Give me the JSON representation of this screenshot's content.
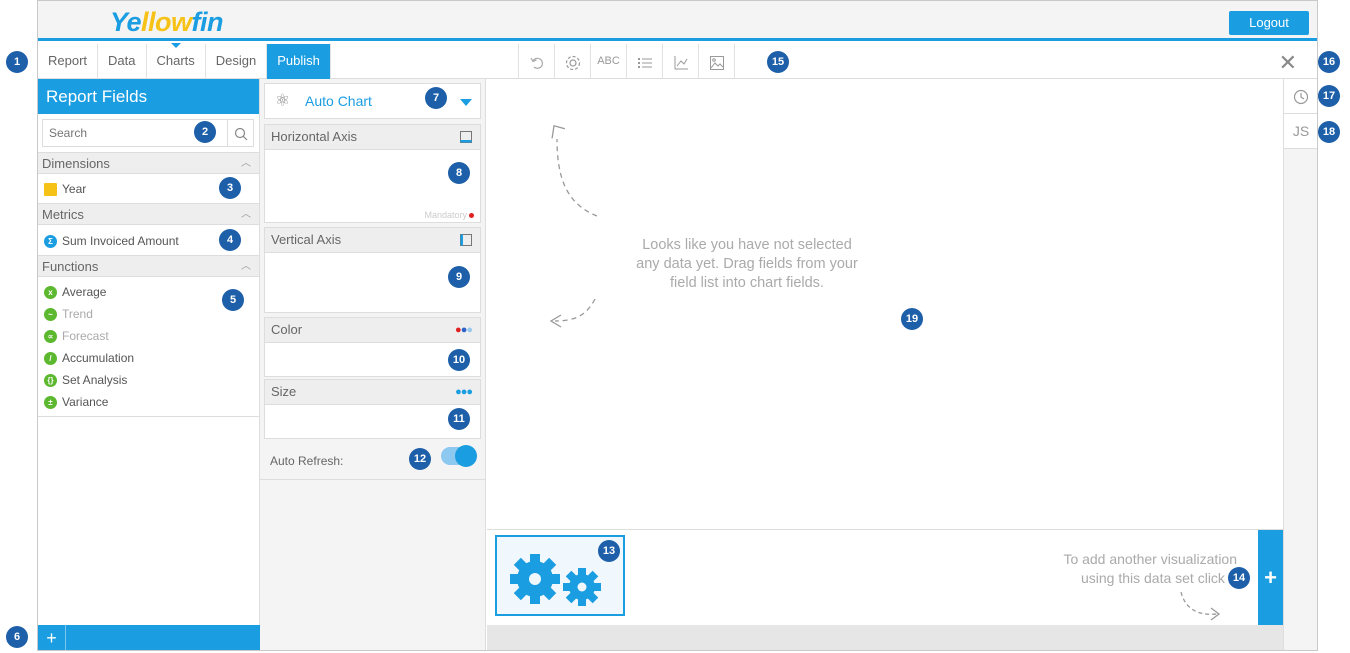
{
  "header": {
    "logo_part1": "Ye",
    "logo_part2": "llow",
    "logo_part3": "fin",
    "logout_label": "Logout"
  },
  "tabs": [
    "Report",
    "Data",
    "Charts",
    "Design",
    "Publish"
  ],
  "toolbar": {
    "text_tool": "ABC",
    "icons": [
      "undo-icon",
      "settings-icon",
      "text-format-icon",
      "legend-icon",
      "axis-icon",
      "image-icon"
    ]
  },
  "left_panel": {
    "title": "Report Fields",
    "search_placeholder": "Search",
    "dimensions": {
      "label": "Dimensions",
      "items": [
        "Year"
      ]
    },
    "metrics": {
      "label": "Metrics",
      "items": [
        "Sum Invoiced Amount"
      ]
    },
    "functions": {
      "label": "Functions",
      "items": [
        {
          "label": "Average",
          "enabled": true
        },
        {
          "label": "Trend",
          "enabled": false
        },
        {
          "label": "Forecast",
          "enabled": false
        },
        {
          "label": "Accumulation",
          "enabled": true
        },
        {
          "label": "Set Analysis",
          "enabled": true
        },
        {
          "label": "Variance",
          "enabled": true
        }
      ]
    },
    "add_label": "+"
  },
  "chart_config": {
    "chart_type": "Auto Chart",
    "horizontal_axis": "Horizontal Axis",
    "mandatory": "Mandatory",
    "vertical_axis": "Vertical Axis",
    "color": "Color",
    "size": "Size",
    "auto_refresh": "Auto Refresh:",
    "auto_refresh_on": true
  },
  "canvas": {
    "empty_line1": "Looks like you have not selected",
    "empty_line2": "any data yet. Drag fields from your",
    "empty_line3": "field list into chart fields.",
    "add_viz_line1": "To add another visualization",
    "add_viz_line2": "using this data set click +",
    "add_viz_button": "+"
  },
  "right_panel": {
    "js_label": "JS"
  },
  "markers": [
    "1",
    "2",
    "3",
    "4",
    "5",
    "6",
    "7",
    "8",
    "9",
    "10",
    "11",
    "12",
    "13",
    "14",
    "15",
    "16",
    "17",
    "18",
    "19"
  ],
  "colors": {
    "accent": "#1a9de1",
    "marker": "#1d5fa8",
    "logo_yellow": "#f7c217",
    "function_green": "#5cb82e"
  }
}
